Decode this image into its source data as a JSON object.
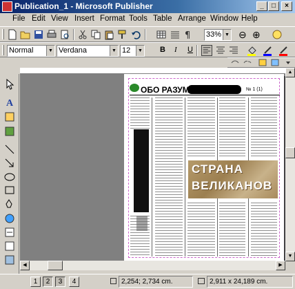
{
  "window": {
    "title": "Publication_1 - Microsoft Publisher",
    "minimize_glyph": "_",
    "maximize_glyph": "□",
    "close_glyph": "×"
  },
  "menu": [
    "File",
    "Edit",
    "View",
    "Insert",
    "Format",
    "Tools",
    "Table",
    "Arrange",
    "Window",
    "Help"
  ],
  "standard_toolbar": {
    "zoom": "33%",
    "zoom_out_glyph": "⊖",
    "zoom_in_glyph": "⊕"
  },
  "formatting_toolbar": {
    "style": "Normal",
    "font": "Verdana",
    "size": "12",
    "bold": "B",
    "italic": "I",
    "underline": "U"
  },
  "page": {
    "masthead": "ОБО РАЗУМА",
    "issue_number": "№ 1 (1)",
    "banner_line1": "СТРАНА",
    "banner_line2": "ВЕЛИКАНОВ"
  },
  "status": {
    "pages": [
      "1",
      "2",
      "3",
      "4"
    ],
    "position": "2,254; 2,734 cm.",
    "size": "2,911 x 24,189 cm."
  },
  "colors": {
    "title_bar": "#0a246a",
    "workspace": "#808080",
    "guides": "#cc66cc"
  }
}
